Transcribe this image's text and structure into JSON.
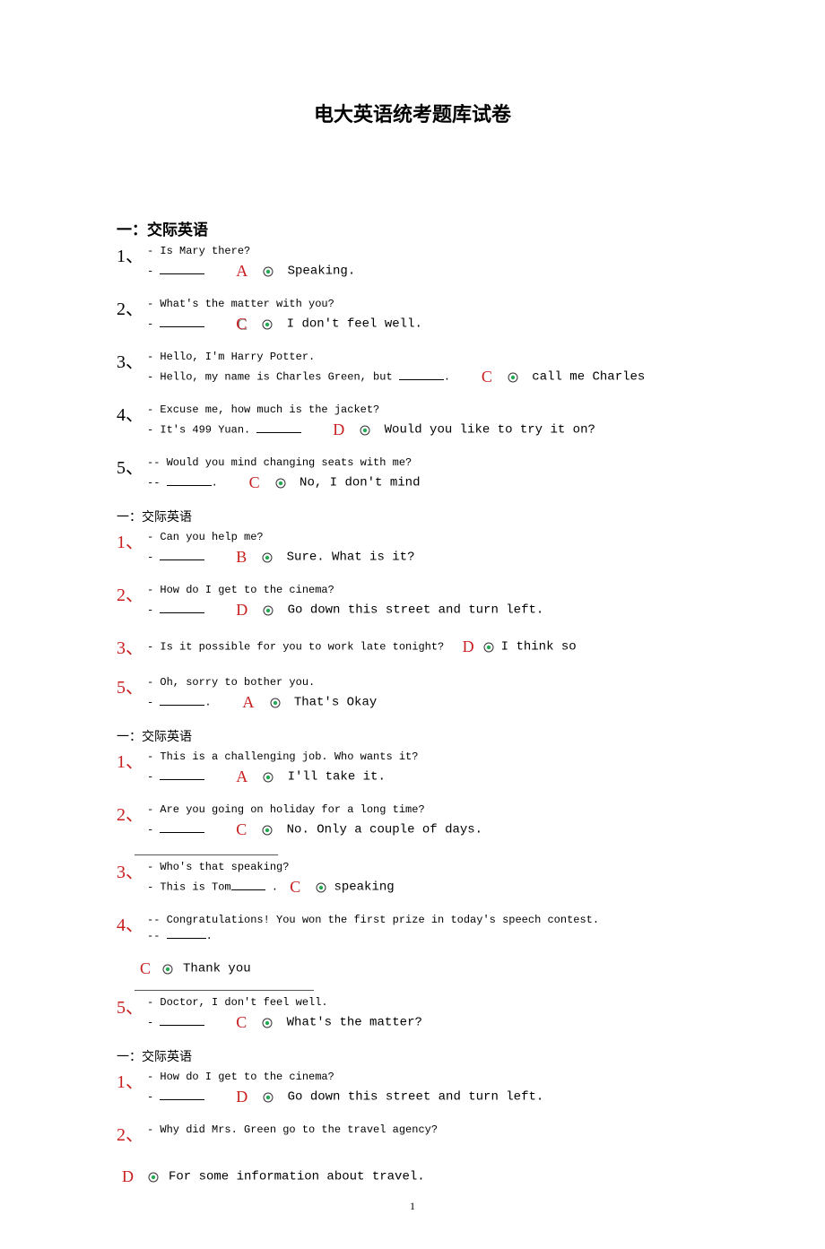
{
  "title": "电大英语统考题库试卷",
  "pagenum": "1",
  "sections": [
    {
      "heading": "一：交际英语",
      "heading_class": "section-heading",
      "questions": [
        {
          "num": "1、",
          "l1": "- Is Mary there?",
          "l2p": "- ",
          "blank": true,
          "ans": "A",
          "opt": "Speaking."
        },
        {
          "num": "2、",
          "l1": "- What's the matter with you?",
          "l2p": "- ",
          "blank": true,
          "ans_special": "C",
          "opt": "I don't feel well."
        },
        {
          "num": "3、",
          "l1": "- Hello, I'm Harry Potter.",
          "l2p": "- Hello, my name is Charles Green, but ",
          "blank": true,
          "after_blank": ".",
          "ans": "C",
          "opt": "call me Charles"
        },
        {
          "num": "4、",
          "l1": "- Excuse me, how much is the jacket?",
          "l2p": "- It's 499 Yuan. ",
          "blank": true,
          "ans": "D",
          "opt": "Would you like to try it on?"
        },
        {
          "num": "5、",
          "l1": "-- Would you mind changing seats with me?",
          "l2p": "-- ",
          "blank": true,
          "after_blank": ".",
          "ans": "C",
          "opt": "No, I don't mind"
        }
      ]
    },
    {
      "heading": "一：交际英语",
      "heading_class": "section-heading-small",
      "questions": [
        {
          "num": "1、",
          "num_red": true,
          "l1": "- Can you help me?",
          "l2p": "- ",
          "blank": true,
          "ans": "B",
          "opt": "Sure. What is it?"
        },
        {
          "num": "2、",
          "num_red": true,
          "l1": "- How do I get to the cinema?",
          "l2p": "- ",
          "blank": true,
          "ans": "D",
          "opt": "Go down this street and turn left."
        },
        {
          "num": "3、",
          "num_red": true,
          "single_line": true,
          "l1": "- Is it possible for you to work late tonight?",
          "ans": "D",
          "opt": "I think so"
        },
        {
          "num": "5、",
          "num_red": true,
          "l1": "- Oh, sorry to bother you.",
          "l2p": "- ",
          "blank": true,
          "after_blank": ".",
          "ans": "A",
          "opt": "That's Okay"
        }
      ]
    },
    {
      "heading": "一：交际英语",
      "heading_class": "section-heading-small",
      "questions": [
        {
          "num": "1、",
          "num_red": true,
          "l1": "- This is a challenging job. Who wants it?",
          "l2p": "- ",
          "blank": true,
          "ans": "A",
          "opt": "I'll take it."
        },
        {
          "num": "2、",
          "num_red": true,
          "l1": "- Are you going on holiday for a long time?",
          "l2p": "- ",
          "blank": true,
          "ans": "C",
          "opt": "No. Only a couple of days."
        },
        {
          "num": "3、",
          "num_red": true,
          "hr_before": true,
          "l1": "- Who's that speaking?",
          "l2p": "- This is Tom",
          "blank": true,
          "after_blank": " .",
          "ans": "C",
          "opt": "speaking",
          "same_line_ans": true
        },
        {
          "num": "4、",
          "num_red": true,
          "l1": "-- Congratulations! You won the first prize in today's speech contest.",
          "l2p": "-- ",
          "blank": true,
          "after_blank": ".",
          "ans": "C",
          "opt": "Thank you",
          "ans_below": true
        },
        {
          "num": "5、",
          "num_red": true,
          "hr_before": true,
          "hr_wide": true,
          "l1": "- Doctor, I don't feel well.",
          "l2p": "- ",
          "blank": true,
          "ans": "C",
          "opt": "What's the matter?"
        }
      ]
    },
    {
      "heading": "一：交际英语",
      "heading_class": "section-heading-small",
      "questions": [
        {
          "num": "1、",
          "num_red": true,
          "l1": "- How do I get to the cinema?",
          "l2p": "- ",
          "blank": true,
          "ans": "D",
          "opt": "Go down this street and turn left."
        },
        {
          "num": "2、",
          "num_red": true,
          "l1_only": true,
          "l1": "- Why did Mrs. Green go to the travel agency?",
          "ans": "D",
          "opt": "For some information about travel.",
          "ans_far_below": true
        }
      ]
    }
  ]
}
